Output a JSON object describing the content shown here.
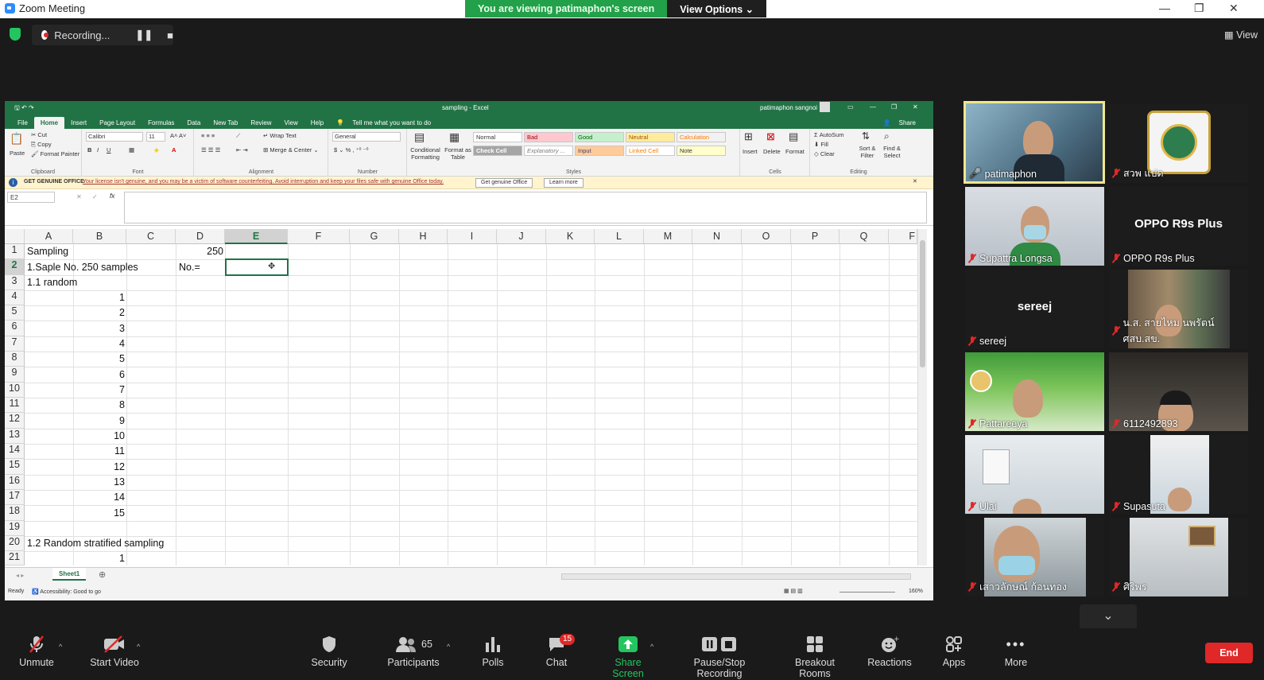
{
  "window": {
    "title": "Zoom Meeting"
  },
  "banner": {
    "viewing": "You are viewing patimaphon's screen",
    "view_options": "View Options"
  },
  "recording": {
    "label": "Recording..."
  },
  "top_right": {
    "view": "View"
  },
  "excel": {
    "title": "sampling - Excel",
    "user": "patimaphon sangnoi",
    "share": "Share",
    "tabs": [
      "File",
      "Home",
      "Insert",
      "Page Layout",
      "Formulas",
      "Data",
      "New Tab",
      "Review",
      "View",
      "Help"
    ],
    "tell_me": "Tell me what you want to do",
    "ribbon": {
      "paste": "Paste",
      "cut": "Cut",
      "copy": "Copy",
      "format_painter": "Format Painter",
      "clipboard": "Clipboard",
      "font_name": "Calibri",
      "font_size": "11",
      "font_group": "Font",
      "wrap_text": "Wrap Text",
      "merge_center": "Merge & Center",
      "alignment": "Alignment",
      "number_format": "General",
      "number": "Number",
      "conditional": "Conditional Formatting",
      "format_table": "Format as Table",
      "styles": [
        "Normal",
        "Bad",
        "Good",
        "Neutral",
        "Calculation",
        "Check Cell",
        "Explanatory ...",
        "Input",
        "Linked Cell",
        "Note"
      ],
      "styles_group": "Styles",
      "insert": "Insert",
      "delete": "Delete",
      "format": "Format",
      "cells": "Cells",
      "autosum": "AutoSum",
      "fill": "Fill",
      "clear": "Clear",
      "sort_filter": "Sort & Filter",
      "find_select": "Find & Select",
      "editing": "Editing"
    },
    "message": {
      "title": "GET GENUINE OFFICE",
      "text": "Your license isn't genuine, and you may be a victim of software counterfeiting. Avoid interruption and keep your files safe with genuine Office today.",
      "btn1": "Get genuine Office",
      "btn2": "Learn more"
    },
    "name_box": "E2",
    "columns": [
      "A",
      "B",
      "C",
      "D",
      "E",
      "F",
      "G",
      "H",
      "I",
      "J",
      "K",
      "L",
      "M",
      "N",
      "O",
      "P",
      "Q",
      "F"
    ],
    "rows": [
      "1",
      "2",
      "3",
      "4",
      "5",
      "6",
      "7",
      "8",
      "9",
      "10",
      "11",
      "12",
      "13",
      "14",
      "15",
      "16",
      "17",
      "18",
      "19",
      "20",
      "21"
    ],
    "cells": {
      "a1": "Sampling",
      "d1": "250",
      "a2": "1.Saple No. 250 samples",
      "d2": "No.=",
      "a3": "1.1 random",
      "b_values": [
        "1",
        "2",
        "3",
        "4",
        "5",
        "6",
        "7",
        "8",
        "9",
        "10",
        "11",
        "12",
        "13",
        "14",
        "15"
      ],
      "a20": "1.2 Random stratified sampling",
      "b21": "1"
    },
    "sheet": "Sheet1",
    "status_ready": "Ready",
    "accessibility": "Accessibility: Good to go",
    "zoom": "160%"
  },
  "participants": [
    {
      "name": "patimaphon"
    },
    {
      "name": "สวพ แปด"
    },
    {
      "name": "Supattra  Longsa"
    },
    {
      "name": "OPPO R9s Plus",
      "display": "OPPO R9s Plus"
    },
    {
      "name": "sereej",
      "display": "sereej"
    },
    {
      "name": "น.ส. สายไหม นพรัตน์ ศสบ.สข."
    },
    {
      "name": "Pattareeya"
    },
    {
      "name": "6112492893"
    },
    {
      "name": "Ulai"
    },
    {
      "name": "Supasuta"
    },
    {
      "name": "เสาวลักษณ์ ก้อนทอง"
    },
    {
      "name": "ศิริพร"
    }
  ],
  "toolbar": {
    "unmute": "Unmute",
    "start_video": "Start Video",
    "security": "Security",
    "participants": "Participants",
    "participants_count": "65",
    "polls": "Polls",
    "chat": "Chat",
    "chat_badge": "15",
    "share_screen": "Share Screen",
    "pause_stop": "Pause/Stop Recording",
    "breakout": "Breakout Rooms",
    "reactions": "Reactions",
    "apps": "Apps",
    "more": "More",
    "end": "End"
  },
  "colors": {
    "zoom_green": "#23a04a",
    "excel_green": "#217346",
    "end_red": "#e02828",
    "active_speaker": "#f0e68c"
  }
}
